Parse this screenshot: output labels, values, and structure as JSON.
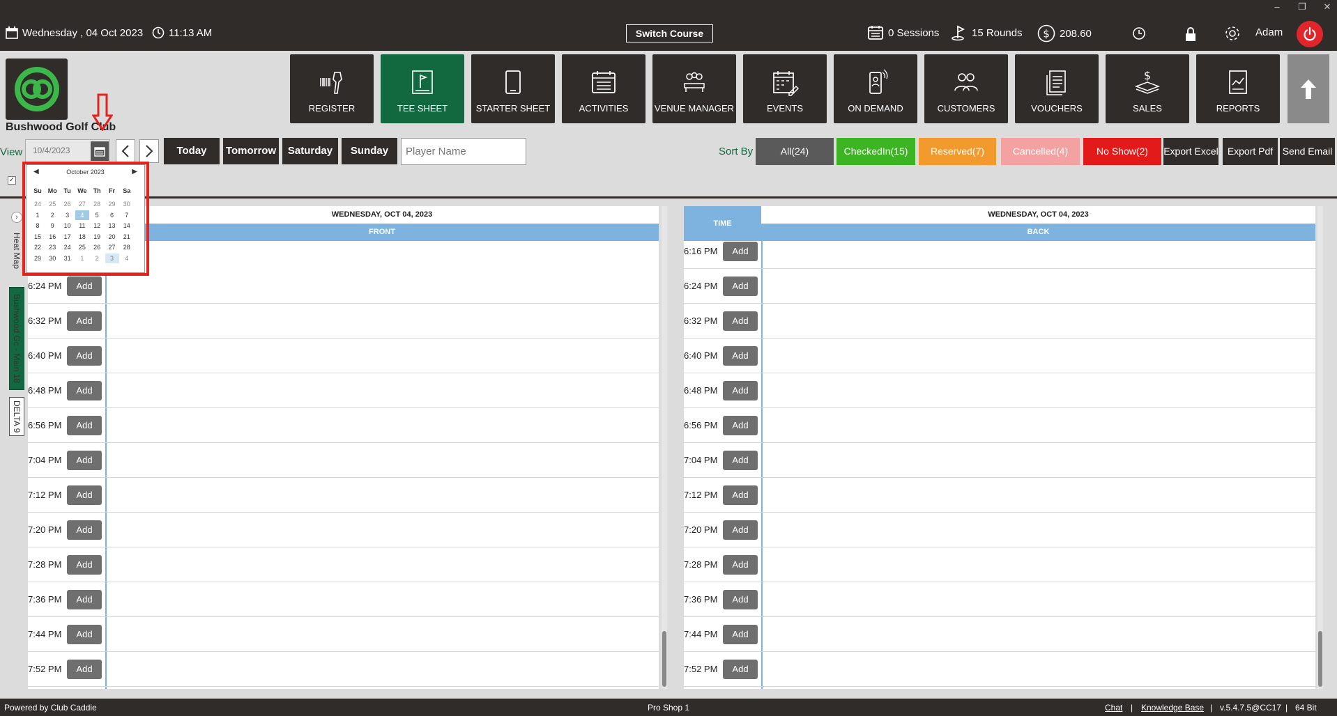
{
  "window": {
    "minimize": "‒",
    "restore": "❐",
    "close": "✕"
  },
  "topbar": {
    "date": "Wednesday ,  04 Oct 2023",
    "time": "11:13 AM",
    "switch_course": "Switch Course",
    "sessions": "0 Sessions",
    "rounds": "15 Rounds",
    "balance": "208.60",
    "user": "Adam"
  },
  "club": {
    "name": "Bushwood Golf Club"
  },
  "nav": [
    {
      "label": "REGISTER",
      "icon": "barcode-scanner-icon"
    },
    {
      "label": "TEE SHEET",
      "icon": "flag-board-icon",
      "active": true
    },
    {
      "label": "STARTER SHEET",
      "icon": "tablet-icon"
    },
    {
      "label": "ACTIVITIES",
      "icon": "calendar-list-icon"
    },
    {
      "label": "VENUE MANAGER",
      "icon": "meeting-icon"
    },
    {
      "label": "EVENTS",
      "icon": "calendar-pencil-icon"
    },
    {
      "label": "ON DEMAND",
      "icon": "mobile-person-icon"
    },
    {
      "label": "CUSTOMERS",
      "icon": "people-icon"
    },
    {
      "label": "VOUCHERS",
      "icon": "documents-icon"
    },
    {
      "label": "SALES",
      "icon": "money-icon"
    },
    {
      "label": "REPORTS",
      "icon": "report-chart-icon"
    }
  ],
  "toolbar": {
    "view_label": "View",
    "date_value": "10/4/2023",
    "today": "Today",
    "tomorrow": "Tomorrow",
    "saturday": "Saturday",
    "sunday": "Sunday",
    "player_placeholder": "Player Name",
    "sort_by": "Sort By",
    "filters": [
      {
        "label": "All(24)",
        "color": "#5a5a5a"
      },
      {
        "label": "CheckedIn(15)",
        "color": "#3db522"
      },
      {
        "label": "Reserved(7)",
        "color": "#f39a2c"
      },
      {
        "label": "Cancelled(4)",
        "color": "#f4a1a1"
      },
      {
        "label": "No Show(2)",
        "color": "#e31a1a"
      }
    ],
    "export_excel": "Export Excel",
    "export_pdf": "Export Pdf",
    "send_email": "Send Email"
  },
  "side_tabs": {
    "heat_map": "Heat Map",
    "course_main": "Bushwood Gc - Main 18",
    "course_delta": "DELTA 9"
  },
  "calendar": {
    "month": "October 2023",
    "weekdays": [
      "Su",
      "Mo",
      "Tu",
      "We",
      "Th",
      "Fr",
      "Sa"
    ],
    "weeks": [
      [
        "24",
        "25",
        "26",
        "27",
        "28",
        "29",
        "30"
      ],
      [
        "1",
        "2",
        "3",
        "4",
        "5",
        "6",
        "7"
      ],
      [
        "8",
        "9",
        "10",
        "11",
        "12",
        "13",
        "14"
      ],
      [
        "15",
        "16",
        "17",
        "18",
        "19",
        "20",
        "21"
      ],
      [
        "22",
        "23",
        "24",
        "25",
        "26",
        "27",
        "28"
      ],
      [
        "29",
        "30",
        "31",
        "1",
        "2",
        "3",
        "4"
      ]
    ],
    "selected": "4",
    "today": "3"
  },
  "front": {
    "date": "WEDNESDAY, OCT 04, 2023",
    "label": "FRONT",
    "times": [
      "6:24 PM",
      "6:32 PM",
      "6:40 PM",
      "6:48 PM",
      "6:56 PM",
      "7:04 PM",
      "7:12 PM",
      "7:20 PM",
      "7:28 PM",
      "7:36 PM",
      "7:44 PM",
      "7:52 PM"
    ]
  },
  "back": {
    "time_header": "TIME",
    "date": "WEDNESDAY, OCT 04, 2023",
    "label": "BACK",
    "times": [
      "6:16 PM",
      "6:24 PM",
      "6:32 PM",
      "6:40 PM",
      "6:48 PM",
      "6:56 PM",
      "7:04 PM",
      "7:12 PM",
      "7:20 PM",
      "7:28 PM",
      "7:36 PM",
      "7:44 PM",
      "7:52 PM"
    ]
  },
  "add_label": "Add",
  "footer": {
    "powered": "Powered by Club Caddie",
    "station": "Pro Shop 1",
    "chat": "Chat",
    "sep": "|",
    "knowledge": "Knowledge Base",
    "version": "v.5.4.7.5@CC17",
    "bits": "64 Bit"
  }
}
